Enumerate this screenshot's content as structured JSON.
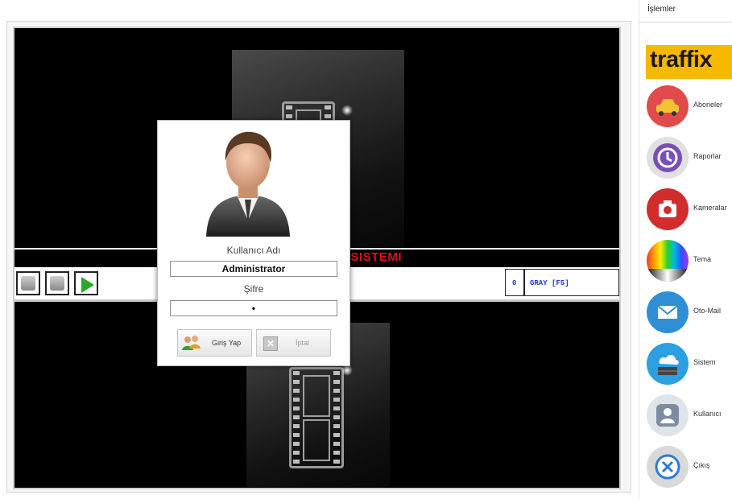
{
  "viewer": {
    "title_band_text": "SISTEMI",
    "counter_value": "0",
    "mode_label": "GRAY [F5]"
  },
  "login": {
    "username_label": "Kullanıcı Adı",
    "username_value": "Administrator",
    "password_label": "Şifre",
    "password_value": "•",
    "login_button": "Giriş Yap",
    "cancel_button": "İptal"
  },
  "sidebar": {
    "header": "İşlemler",
    "brand": "traffix",
    "items": [
      {
        "label": "Aboneler",
        "color": "#e24b4b"
      },
      {
        "label": "Raporlar",
        "color": "#7a4fb5"
      },
      {
        "label": "Kameralar",
        "color": "#d12d2d"
      },
      {
        "label": "Tema",
        "color": "#b0b0b0"
      },
      {
        "label": "Oto-Mail",
        "color": "#2f8fd6"
      },
      {
        "label": "Sistem",
        "color": "#2b9fe0"
      },
      {
        "label": "Kullanıcı",
        "color": "#7d8ca3"
      },
      {
        "label": "Çıkış",
        "color": "#2f7ad6"
      }
    ]
  }
}
